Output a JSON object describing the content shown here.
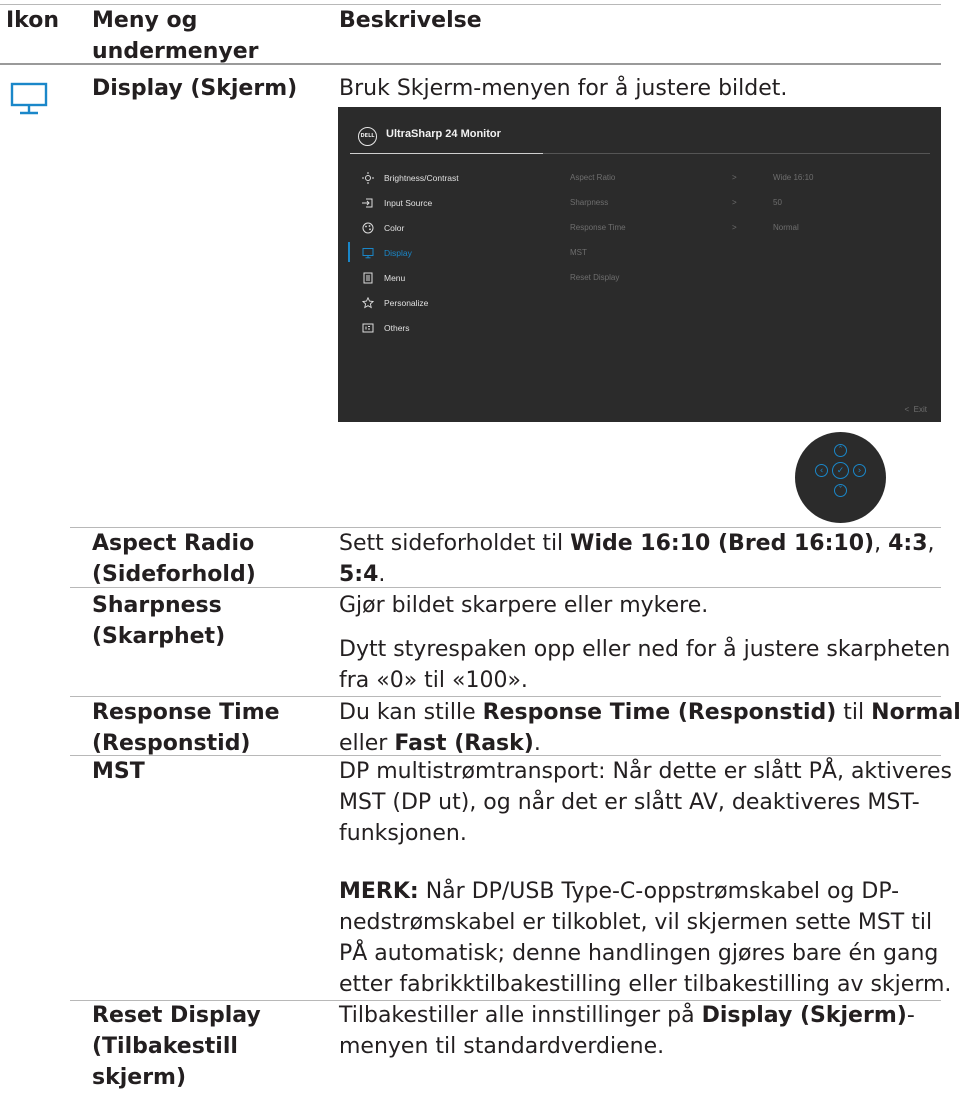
{
  "header": {
    "col1": "Ikon",
    "col2_line1": "Meny og",
    "col2_line2": "undermenyer",
    "col3": "Beskrivelse"
  },
  "display_row": {
    "name": "Display (Skjerm)",
    "description": "Bruk Skjerm-menyen for å justere bildet."
  },
  "osd": {
    "logo_text": "DELL",
    "title": "UltraSharp 24 Monitor",
    "menu": [
      {
        "label": "Brightness/Contrast",
        "icon": "sun-icon"
      },
      {
        "label": "Input Source",
        "icon": "input-icon"
      },
      {
        "label": "Color",
        "icon": "palette-icon"
      },
      {
        "label": "Display",
        "icon": "monitor-icon"
      },
      {
        "label": "Menu",
        "icon": "menu-icon"
      },
      {
        "label": "Personalize",
        "icon": "star-icon"
      },
      {
        "label": "Others",
        "icon": "others-icon"
      }
    ],
    "submenu": [
      {
        "label": "Aspect Ratio",
        "arrow": ">",
        "value": "Wide 16:10"
      },
      {
        "label": "Sharpness",
        "arrow": ">",
        "value": "50"
      },
      {
        "label": "Response Time",
        "arrow": ">",
        "value": "Normal"
      },
      {
        "label": "MST",
        "arrow": "",
        "value": ""
      },
      {
        "label": "Reset Display",
        "arrow": "",
        "value": ""
      }
    ],
    "exit_label": "Exit",
    "accent_color": "#1a87c9"
  },
  "rows": {
    "aspect": {
      "name_l1": "Aspect Radio",
      "name_l2": "(Sideforhold)",
      "desc_pre": "Sett sideforholdet til ",
      "desc_b1": "Wide 16:10 (Bred 16:10)",
      "desc_sep1": ", ",
      "desc_b2": "4:3",
      "desc_sep2": ",",
      "desc_b3": "5:4",
      "desc_end": "."
    },
    "sharpness": {
      "name_l1": "Sharpness",
      "name_l2": "(Skarphet)",
      "desc1": "Gjør bildet skarpere eller mykere.",
      "desc2_l1": "Dytt styrespaken opp eller ned for å justere skarpheten",
      "desc2_l2": "fra «0» til «100»."
    },
    "response": {
      "name_l1": "Response Time",
      "name_l2": "(Responstid)",
      "l1_pre": "Du kan stille ",
      "l1_b1": "Response Time (Responstid)",
      "l1_mid": " til ",
      "l1_b2": "Normal",
      "l2_pre": "eller ",
      "l2_b": "Fast (Rask)",
      "l2_end": "."
    },
    "mst": {
      "name": "MST",
      "p1_l1": "DP multistrømtransport: Når dette er slått PÅ, aktiveres",
      "p1_l2": "MST (DP ut), og når det er slått AV, deaktiveres MST-",
      "p1_l3": "funksjonen.",
      "note_label": "MERK:",
      "p2_l1": " Når DP/USB Type-C-oppstrømskabel og DP-",
      "p2_l2": "nedstrømskabel er tilkoblet, vil skjermen sette MST til",
      "p2_l3": "PÅ automatisk; denne handlingen gjøres bare én gang",
      "p2_l4": "etter fabrikktilbakestilling eller tilbakestilling av skjerm."
    },
    "reset": {
      "name_l1": "Reset Display",
      "name_l2": "(Tilbakestill",
      "name_l3": "skjerm)",
      "l1_pre": "Tilbakestiller alle innstillinger på ",
      "l1_b": "Display (Skjerm)",
      "l1_end": "-",
      "l2": "menyen til standardverdiene."
    }
  }
}
